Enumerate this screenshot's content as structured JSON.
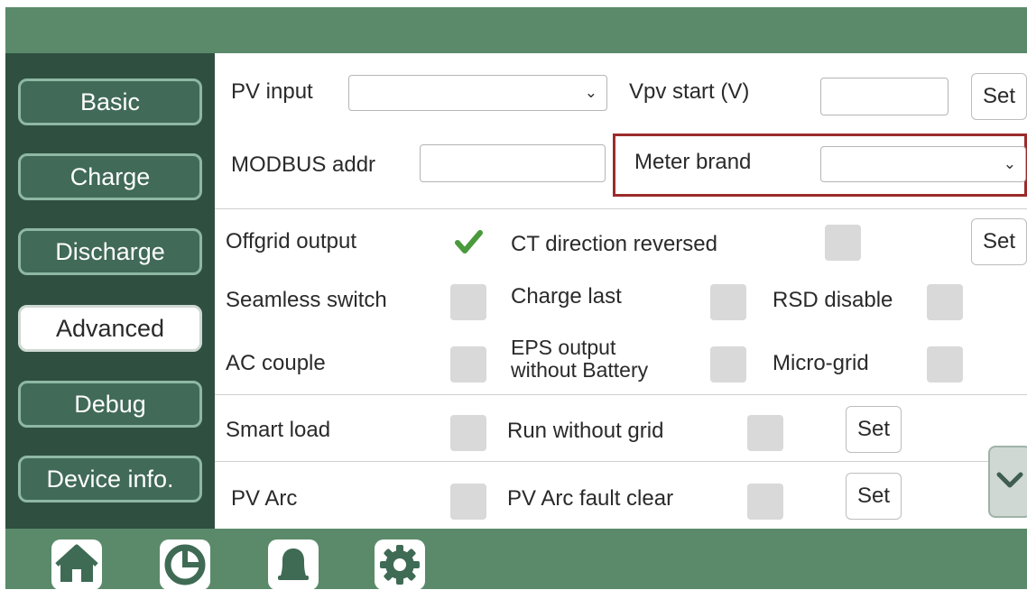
{
  "sidebar": {
    "items": [
      {
        "label": "Basic"
      },
      {
        "label": "Charge"
      },
      {
        "label": "Discharge"
      },
      {
        "label": "Advanced"
      },
      {
        "label": "Debug"
      },
      {
        "label": "Device info."
      }
    ],
    "active": "Advanced"
  },
  "top": {
    "pv_input_label": "PV input",
    "pv_input_value": "",
    "vpv_start_label": "Vpv start (V)",
    "vpv_start_value": "",
    "modbus_label": "MODBUS addr",
    "modbus_value": "",
    "meter_brand_label": "Meter brand",
    "meter_brand_value": "",
    "set_label": "Set"
  },
  "options": {
    "offgrid_output": {
      "label": "Offgrid output",
      "checked": true
    },
    "ct_direction": {
      "label": "CT direction reversed",
      "checked": false
    },
    "seamless_switch": {
      "label": "Seamless switch",
      "checked": false
    },
    "charge_last": {
      "label": "Charge last",
      "checked": false
    },
    "rsd_disable": {
      "label": "RSD disable",
      "checked": false
    },
    "ac_couple": {
      "label": "AC couple",
      "checked": false
    },
    "eps_output": {
      "label_line1": "EPS output",
      "label_line2": "without Battery",
      "checked": false
    },
    "micro_grid": {
      "label": "Micro-grid",
      "checked": false
    },
    "set_label": "Set"
  },
  "smart": {
    "smart_load": {
      "label": "Smart load",
      "checked": false
    },
    "run_without_grid": {
      "label": "Run without grid",
      "checked": false
    },
    "set_label": "Set"
  },
  "arc": {
    "pv_arc": {
      "label": "PV Arc",
      "checked": false
    },
    "pv_arc_fault_clear": {
      "label": "PV Arc fault clear",
      "checked": false
    },
    "set_label": "Set"
  },
  "bottom_nav": [
    "home-icon",
    "pie-chart-icon",
    "bell-icon",
    "gear-icon"
  ],
  "colors": {
    "header_green": "#5a8a6a",
    "sidebar_dark": "#2f5040",
    "button_green": "#416a58",
    "highlight_red": "#9b2b2b",
    "check_green": "#4a9a3c"
  }
}
